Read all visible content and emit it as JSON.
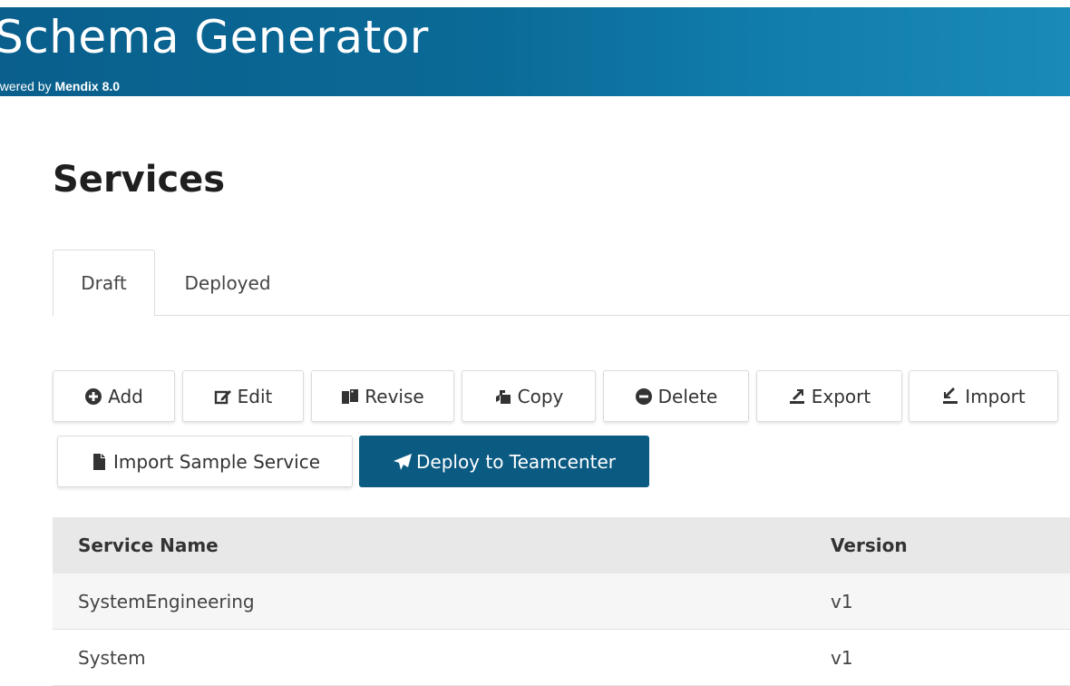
{
  "header": {
    "title": "Schema Generator",
    "powered_prefix": "owered by",
    "powered_brand": "Mendix 8.0"
  },
  "page": {
    "title": "Services"
  },
  "tabs": [
    {
      "label": "Draft",
      "active": true
    },
    {
      "label": "Deployed",
      "active": false
    }
  ],
  "toolbar": {
    "add": "Add",
    "edit": "Edit",
    "revise": "Revise",
    "copy": "Copy",
    "delete": "Delete",
    "export": "Export",
    "import": "Import",
    "import_sample": "Import Sample Service",
    "deploy": "Deploy to Teamcenter"
  },
  "table": {
    "columns": [
      "Service Name",
      "Version"
    ],
    "rows": [
      {
        "name": "SystemEngineering",
        "version": "v1"
      },
      {
        "name": "System",
        "version": "v1"
      }
    ]
  },
  "colors": {
    "banner": "#0b6a97",
    "primary_button": "#0b5a82",
    "table_header": "#e8e8e8"
  }
}
